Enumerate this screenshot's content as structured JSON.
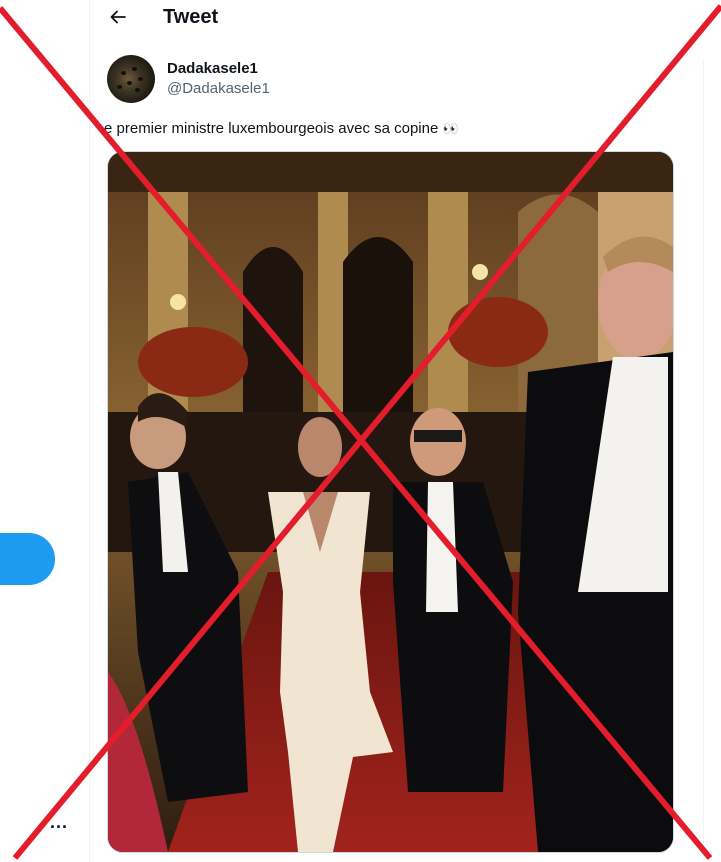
{
  "header": {
    "title": "Tweet"
  },
  "tweet": {
    "author": {
      "display_name": "Dadakasele1",
      "handle": "@Dadakasele1"
    },
    "text": "e premier ministre luxembourgeois avec sa copine",
    "emoji": "👀"
  },
  "sidebar": {
    "more_label": "..."
  },
  "colors": {
    "accent": "#1d9bf0",
    "cross": "#e31d2b",
    "muted": "#536471"
  },
  "icons": {
    "back": "arrow-left-icon"
  }
}
